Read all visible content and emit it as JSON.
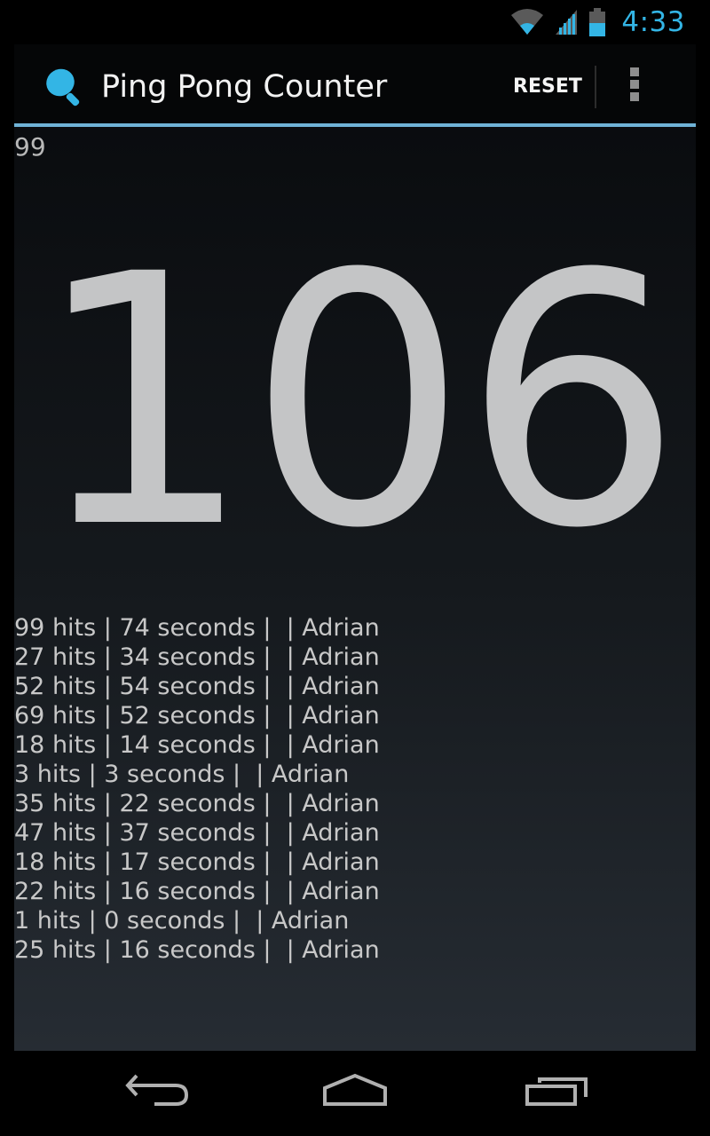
{
  "status_bar": {
    "time": "4:33",
    "icons": [
      "wifi-icon",
      "signal-icon",
      "battery-icon"
    ],
    "accent_color": "#33b5e5"
  },
  "action_bar": {
    "app_icon": "paddle-icon",
    "title": "Ping Pong Counter",
    "reset_label": "RESET",
    "overflow_icon": "overflow-menu-icon",
    "accent_color": "#6fb2d6"
  },
  "main": {
    "previous_score": "99",
    "counter": "106",
    "history": [
      "99 hits | 74 seconds |  | Adrian",
      "27 hits | 34 seconds |  | Adrian",
      "52 hits | 54 seconds |  | Adrian",
      "69 hits | 52 seconds |  | Adrian",
      "18 hits | 14 seconds |  | Adrian",
      "3 hits | 3 seconds |  | Adrian",
      "35 hits | 22 seconds |  | Adrian",
      "47 hits | 37 seconds |  | Adrian",
      "18 hits | 17 seconds |  | Adrian",
      "22 hits | 16 seconds |  | Adrian",
      "1 hits | 0 seconds |  | Adrian",
      "25 hits | 16 seconds |  | Adrian"
    ]
  },
  "nav_bar": {
    "buttons": [
      "back-icon",
      "home-icon",
      "recent-apps-icon"
    ]
  }
}
